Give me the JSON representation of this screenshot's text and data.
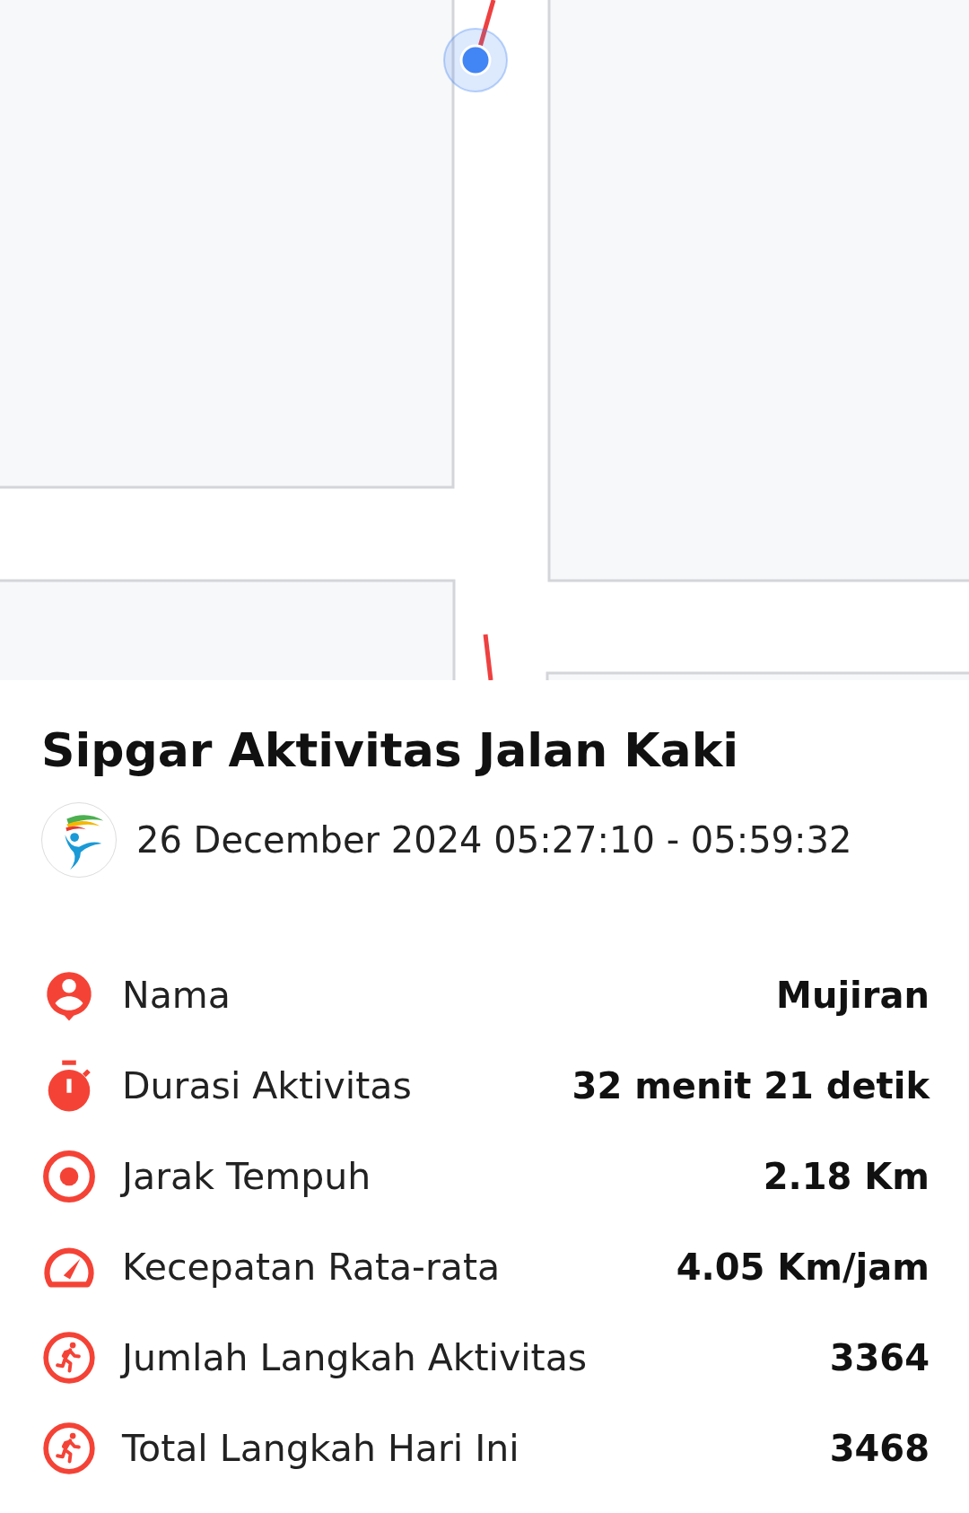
{
  "title": "Sipgar Aktivitas Jalan Kaki",
  "time_range": "26 December 2024 05:27:10 - 05:59:32",
  "stats": [
    {
      "label": "Nama",
      "value": "Mujiran"
    },
    {
      "label": "Durasi Aktivitas",
      "value": "32 menit 21 detik"
    },
    {
      "label": "Jarak Tempuh",
      "value": "2.18 Km"
    },
    {
      "label": "Kecepatan Rata-rata",
      "value": "4.05 Km/jam"
    },
    {
      "label": "Jumlah Langkah Aktivitas",
      "value": "3364"
    },
    {
      "label": "Total Langkah Hari Ini",
      "value": "3468"
    }
  ]
}
